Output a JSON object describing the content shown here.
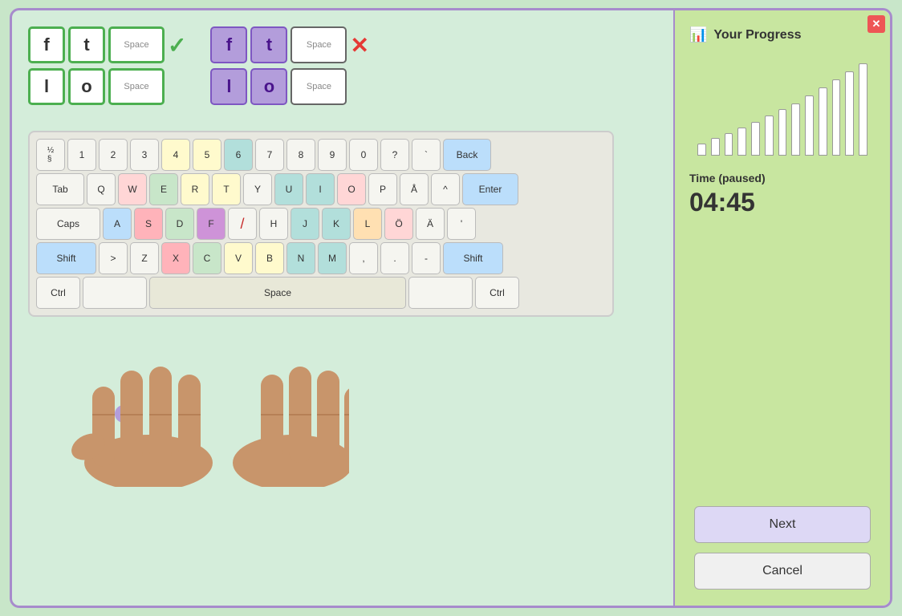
{
  "window": {
    "close_label": "✕"
  },
  "word_display": {
    "correct_group": {
      "row1": [
        "f",
        "t",
        "Space"
      ],
      "row2": [
        "l",
        "o",
        "Space"
      ],
      "status": "✓"
    },
    "current_group": {
      "row1": [
        "f",
        "t",
        "Space"
      ],
      "row2": [
        "l",
        "o",
        "Space"
      ],
      "status": "✕"
    }
  },
  "keyboard": {
    "row0": [
      {
        "label": "½\n§",
        "class": ""
      },
      {
        "label": "1\n!",
        "class": ""
      },
      {
        "label": "2\n\"",
        "class": ""
      },
      {
        "label": "3\n#",
        "class": ""
      },
      {
        "label": "4",
        "class": "yellow"
      },
      {
        "label": "5\n%",
        "class": "yellow"
      },
      {
        "label": "6\n&",
        "class": "teal"
      },
      {
        "label": "7\n/",
        "class": ""
      },
      {
        "label": "8\n(",
        "class": ""
      },
      {
        "label": "9\n)",
        "class": ""
      },
      {
        "label": "0\n=",
        "class": ""
      },
      {
        "label": "?\n+",
        "class": ""
      },
      {
        "label": "`\n\\",
        "class": ""
      },
      {
        "label": "Back",
        "class": "wide blue"
      }
    ],
    "row1": [
      {
        "label": "Tab",
        "class": "wide"
      },
      {
        "label": "Q",
        "class": ""
      },
      {
        "label": "W",
        "class": "light-pink"
      },
      {
        "label": "E",
        "class": "green"
      },
      {
        "label": "R",
        "class": "yellow"
      },
      {
        "label": "T",
        "class": "yellow"
      },
      {
        "label": "Y",
        "class": ""
      },
      {
        "label": "U",
        "class": "teal"
      },
      {
        "label": "I",
        "class": "teal"
      },
      {
        "label": "O",
        "class": "light-pink"
      },
      {
        "label": "P",
        "class": ""
      },
      {
        "label": "Å",
        "class": ""
      },
      {
        "label": "^",
        "class": ""
      },
      {
        "label": "Enter",
        "class": "enter-key blue"
      }
    ],
    "row2": [
      {
        "label": "Caps",
        "class": "wider"
      },
      {
        "label": "A",
        "class": "blue"
      },
      {
        "label": "S",
        "class": "pink"
      },
      {
        "label": "D",
        "class": "green"
      },
      {
        "label": "F",
        "class": "dark-purple"
      },
      {
        "label": "/",
        "class": "slash-key"
      },
      {
        "label": "H",
        "class": ""
      },
      {
        "label": "J",
        "class": "teal"
      },
      {
        "label": "K",
        "class": "teal"
      },
      {
        "label": "L",
        "class": "orange"
      },
      {
        "label": "Ö",
        "class": "light-pink"
      },
      {
        "label": "Ä",
        "class": ""
      },
      {
        "label": "';",
        "class": ""
      }
    ],
    "row3": [
      {
        "label": "Shift",
        "class": "shift-key blue"
      },
      {
        "label": ">\n<",
        "class": ""
      },
      {
        "label": "Z",
        "class": ""
      },
      {
        "label": "X",
        "class": "pink"
      },
      {
        "label": "C",
        "class": "green"
      },
      {
        "label": "V",
        "class": "yellow"
      },
      {
        "label": "B",
        "class": "yellow"
      },
      {
        "label": "N",
        "class": "teal"
      },
      {
        "label": "M",
        "class": "teal"
      },
      {
        "label": ",\n;",
        "class": ""
      },
      {
        "label": ".\n:",
        "class": ""
      },
      {
        "label": "-\n_",
        "class": ""
      },
      {
        "label": "Shift",
        "class": "shift-key blue"
      }
    ],
    "row4": [
      {
        "label": "Ctrl",
        "class": "ctrl-key"
      },
      {
        "label": "",
        "class": "wider"
      },
      {
        "label": "Space",
        "class": "space-bar"
      },
      {
        "label": "",
        "class": "wider"
      },
      {
        "label": "Ctrl",
        "class": "ctrl-key"
      }
    ]
  },
  "progress": {
    "title": "Your Progress",
    "chart_bars": [
      15,
      22,
      28,
      35,
      42,
      50,
      58,
      65,
      75,
      85,
      95,
      105,
      115
    ],
    "time_label": "Time (paused)",
    "time_value": "04:45"
  },
  "buttons": {
    "next_label": "Next",
    "cancel_label": "Cancel"
  }
}
